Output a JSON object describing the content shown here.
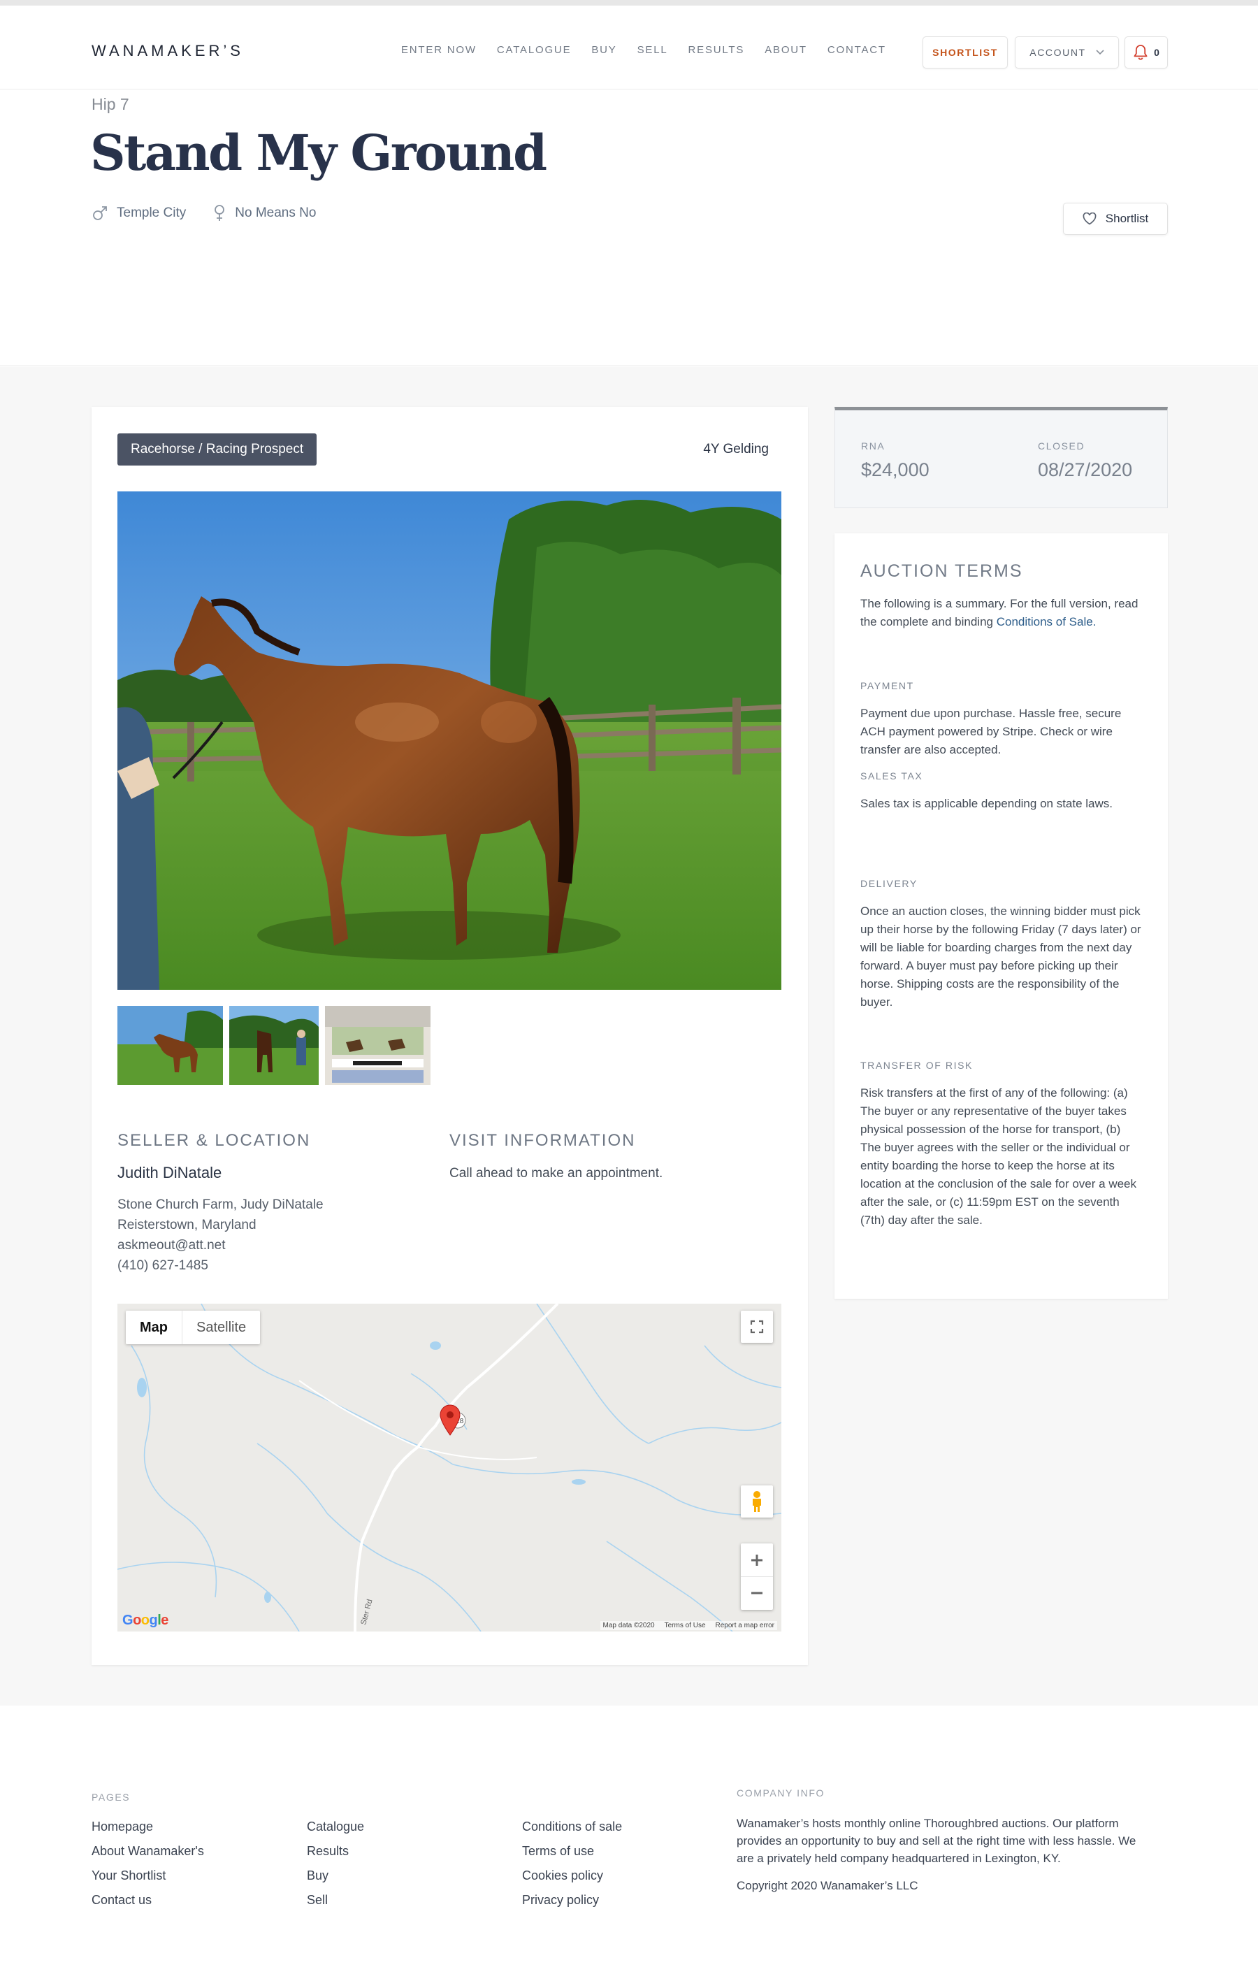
{
  "header": {
    "logo": "WANAMAKER’S",
    "nav": [
      "ENTER NOW",
      "CATALOGUE",
      "BUY",
      "SELL",
      "RESULTS",
      "ABOUT",
      "CONTACT"
    ],
    "shortlist_label": "SHORTLIST",
    "account_label": "ACCOUNT",
    "notification_count": "0"
  },
  "listing": {
    "hip": "Hip 7",
    "name": "Stand My Ground",
    "sire": "Temple City",
    "dam": "No Means No",
    "shortlist_label": "Shortlist",
    "category": "Racehorse / Racing Prospect",
    "age_sex": "4Y Gelding"
  },
  "seller": {
    "heading": "SELLER & LOCATION",
    "name": "Judith DiNatale",
    "lines": [
      "Stone Church Farm, Judy DiNatale",
      "Reisterstown, Maryland",
      "askmeout@att.net",
      "(410) 627-1485"
    ]
  },
  "visit": {
    "heading": "VISIT INFORMATION",
    "text": "Call ahead to make an appointment."
  },
  "map": {
    "toggle_map": "Map",
    "toggle_satellite": "Satellite",
    "route_badge": "128",
    "road_label": "Ster Rd",
    "footer": [
      "Map data ©2020",
      "Terms of Use",
      "Report a map error"
    ],
    "google_letters": [
      "G",
      "o",
      "o",
      "g",
      "l",
      "e"
    ],
    "google_colors": [
      "#4285f4",
      "#ea4335",
      "#fbbc05",
      "#4285f4",
      "#34a853",
      "#ea4335"
    ]
  },
  "result": {
    "status_label": "RNA",
    "price": "$24,000",
    "closed_label": "CLOSED",
    "closed_date": "08/27/2020"
  },
  "terms": {
    "heading": "AUCTION TERMS",
    "intro": "The following is a summary. For the full version, read the complete and binding",
    "intro_link": "Conditions of Sale.",
    "sections": [
      {
        "title": "PAYMENT",
        "text": "Payment due upon purchase. Hassle free, secure ACH payment powered by Stripe. Check or wire transfer are also accepted."
      },
      {
        "title": "SALES TAX",
        "text": "Sales tax is applicable depending on state laws."
      },
      {
        "title": "DELIVERY",
        "text": "Once an auction closes, the winning bidder must pick up their horse by the following Friday (7 days later) or will be liable for boarding charges from the next day forward. A buyer must pay before picking up their horse. Shipping costs are the responsibility of the buyer."
      },
      {
        "title": "TRANSFER OF RISK",
        "text": "Risk transfers at the first of any of the following: (a) The buyer or any representative of the buyer takes physical possession of the horse for transport, (b) The buyer agrees with the seller or the individual or entity boarding the horse to keep the horse at its location at the conclusion of the sale for over a week after the sale, or (c) 11:59pm EST on the seventh (7th) day after the sale."
      }
    ]
  },
  "footer": {
    "pages_label": "PAGES",
    "col1": [
      "Homepage",
      "About Wanamaker's",
      "Your Shortlist",
      "Contact us"
    ],
    "col2": [
      "Catalogue",
      "Results",
      "Buy",
      "Sell"
    ],
    "col3": [
      "Conditions of sale",
      "Terms of use",
      "Cookies policy",
      "Privacy policy"
    ],
    "company_label": "COMPANY INFO",
    "company_text": "Wanamaker’s hosts monthly online Thoroughbred auctions. Our platform provides an opportunity to buy and sell at the right time with less hassle. We are a privately held company headquartered in Lexington, KY.",
    "copyright": "Copyright 2020 Wanamaker’s LLC"
  },
  "colors": {
    "accent": "#c4531a",
    "navy": "#28324a",
    "tag_bg": "#4b5364",
    "link": "#2d5d8a"
  },
  "icons": [
    "bell-icon",
    "chevron-down-icon",
    "male-icon",
    "female-icon",
    "heart-icon",
    "fullscreen-icon",
    "pegman-icon",
    "zoom-in-icon",
    "zoom-out-icon",
    "map-pin-icon"
  ]
}
